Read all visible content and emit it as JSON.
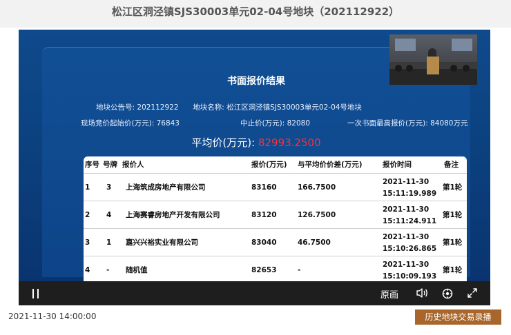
{
  "page_title": "松江区洞泾镇SJS30003单元02-04号地块（202112922）",
  "board": {
    "title": "书面报价结果",
    "announcement_label": "地块公告号:",
    "announcement_no": "202112922",
    "parcel_label": "地块名称:",
    "parcel_name": "松江区洞泾镇SJS30003单元02-04号地块",
    "start_price_label": "现场竞价起始价(万元):",
    "start_price": "76843",
    "stop_price_label": "中止价(万元):",
    "stop_price": "82080",
    "highest_bid_label": "一次书面最高报价(万元):",
    "highest_bid": "84080万元",
    "average_label": "平均价(万元):",
    "average_value": "82993.2500"
  },
  "table": {
    "headers": [
      "序号",
      "号牌",
      "报价人",
      "报价(万元)",
      "与平均价价差(万元)",
      "报价时间",
      "备注"
    ],
    "rows": [
      {
        "seq": "1",
        "no": "3",
        "bidder": "上海筑成房地产有限公司",
        "price": "83160",
        "diff": "166.7500",
        "date": "2021-11-30",
        "time": "15:11:19.989",
        "note": "第1轮"
      },
      {
        "seq": "2",
        "no": "4",
        "bidder": "上海赛睿房地产开发有限公司",
        "price": "83120",
        "diff": "126.7500",
        "date": "2021-11-30",
        "time": "15:11:24.911",
        "note": "第1轮"
      },
      {
        "seq": "3",
        "no": "1",
        "bidder": "嘉兴兴裕实业有限公司",
        "price": "83040",
        "diff": "46.7500",
        "date": "2021-11-30",
        "time": "15:10:26.865",
        "note": "第1轮"
      },
      {
        "seq": "4",
        "no": "-",
        "bidder": "随机值",
        "price": "82653",
        "diff": "-",
        "date": "2021-11-30",
        "time": "15:10:09.193",
        "note": "第1轮"
      }
    ]
  },
  "player": {
    "quality_label": "原画",
    "pause_icon": "pause-icon",
    "volume_icon": "volume-icon",
    "settings_icon": "settings-icon",
    "fullscreen_icon": "fullscreen-icon"
  },
  "footer": {
    "date": "2021-11-30 14:00:00",
    "history_button": "历史地块交易录播"
  },
  "colors": {
    "average_value": "#ff3030",
    "history_button_bg": "#a8662c",
    "board_bg": "#0f4a8c"
  }
}
